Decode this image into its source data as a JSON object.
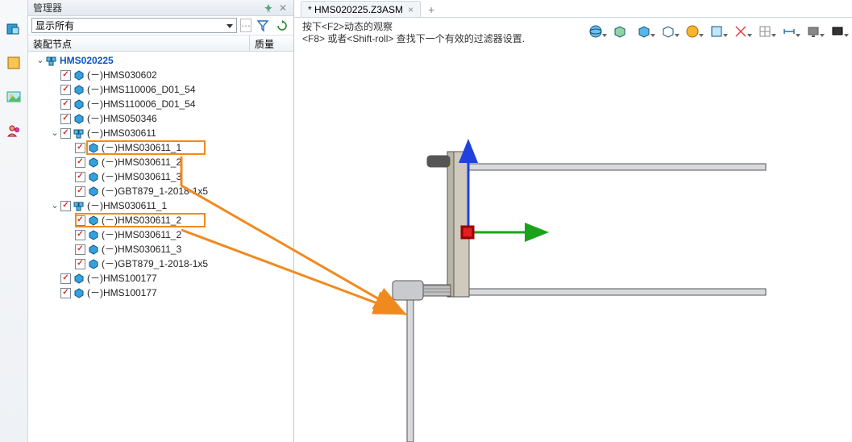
{
  "panel": {
    "title": "管理器",
    "filter_option": "显示所有",
    "col_nodes": "装配节点",
    "col_mass": "质量"
  },
  "tree": {
    "root": "HMS020225",
    "n1": "(－)HMS030602",
    "n2": "(－)HMS110006_D01_54",
    "n3": "(－)HMS110006_D01_54",
    "n4": "(－)HMS050346",
    "asm1": "(－)HMS030611",
    "a1_1": "(－)HMS030611_1",
    "a1_2": "(－)HMS030611_2",
    "a1_3": "(－)HMS030611_3",
    "a1_4": "(－)GBT879_1-2018-1x5",
    "asm2": "(－)HMS030611_1",
    "a2_1": "(－)HMS030611_2",
    "a2_2": "(－)HMS030611_2",
    "a2_3": "(－)HMS030611_3",
    "a2_4": "(－)GBT879_1-2018-1x5",
    "n5": "(－)HMS100177",
    "n6": "(－)HMS100177"
  },
  "tab": {
    "label": "* HMS020225.Z3ASM"
  },
  "hints": {
    "line1": "按下<F2>动态的观察",
    "line2": "<F8> 或者<Shift-roll> 查找下一个有效的过滤器设置."
  },
  "icons": {
    "pin": "📌",
    "dropdown": "▾",
    "close_panel": "✕",
    "funnel": "⌄",
    "refresh": "⟳",
    "vt1": "assembly-icon",
    "vt2": "part-icon",
    "vt3": "image-icon",
    "vt4": "user-icon",
    "tab_close": "×",
    "tab_add": "+"
  },
  "colors": {
    "highlight": "#f08a1f",
    "link": "#0a54c6",
    "axis_x": "#e02020",
    "axis_y": "#1aa31a",
    "axis_z": "#2040e0"
  }
}
